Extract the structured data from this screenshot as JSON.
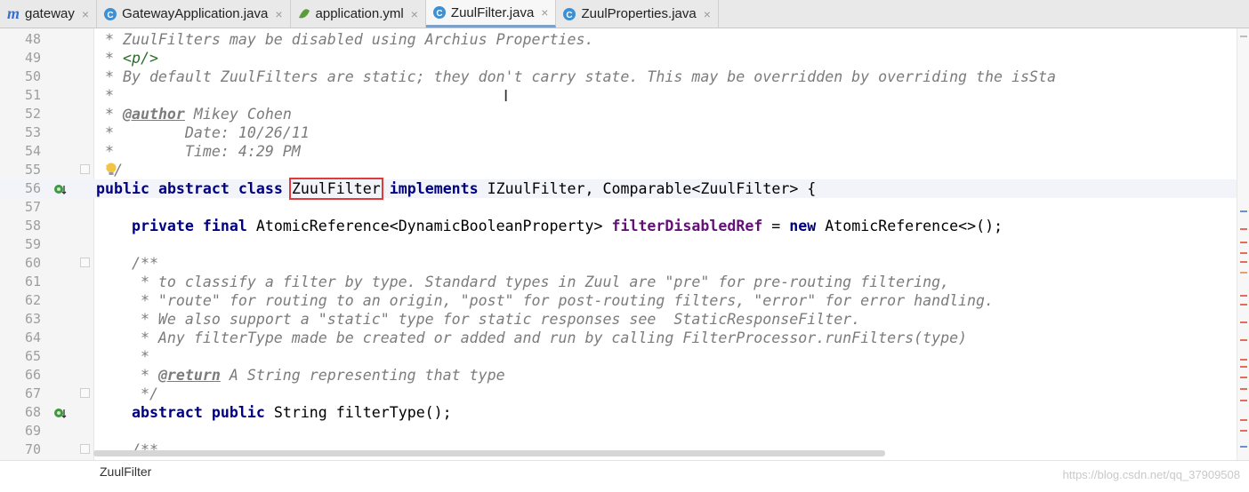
{
  "tabs": [
    {
      "label": "gateway",
      "icon": "maven-module-icon",
      "active": false
    },
    {
      "label": "GatewayApplication.java",
      "icon": "java-class-icon",
      "active": false
    },
    {
      "label": "application.yml",
      "icon": "yaml-file-icon",
      "active": false
    },
    {
      "label": "ZuulFilter.java",
      "icon": "java-class-icon",
      "active": true
    },
    {
      "label": "ZuulProperties.java",
      "icon": "java-class-icon",
      "active": false
    }
  ],
  "code": {
    "lines": [
      {
        "n": "48",
        "t": " * ZuulFilters may be disabled using Archius Properties."
      },
      {
        "n": "49",
        "t": " * <p/>"
      },
      {
        "n": "50",
        "t": " * By default ZuulFilters are static; they don't carry state. This may be overridden by overriding the isSta"
      },
      {
        "n": "51",
        "t": " *"
      },
      {
        "n": "52",
        "t": " * @author Mikey Cohen"
      },
      {
        "n": "53",
        "t": " *        Date: 10/26/11"
      },
      {
        "n": "54",
        "t": " *        Time: 4:29 PM"
      },
      {
        "n": "55",
        "t": " */"
      },
      {
        "n": "56",
        "t": "public abstract class ZuulFilter implements IZuulFilter, Comparable<ZuulFilter> {"
      },
      {
        "n": "57",
        "t": ""
      },
      {
        "n": "58",
        "t": "    private final AtomicReference<DynamicBooleanProperty> filterDisabledRef = new AtomicReference<>();"
      },
      {
        "n": "59",
        "t": ""
      },
      {
        "n": "60",
        "t": "    /**"
      },
      {
        "n": "61",
        "t": "     * to classify a filter by type. Standard types in Zuul are \"pre\" for pre-routing filtering,"
      },
      {
        "n": "62",
        "t": "     * \"route\" for routing to an origin, \"post\" for post-routing filters, \"error\" for error handling."
      },
      {
        "n": "63",
        "t": "     * We also support a \"static\" type for static responses see  StaticResponseFilter."
      },
      {
        "n": "64",
        "t": "     * Any filterType made be created or added and run by calling FilterProcessor.runFilters(type)"
      },
      {
        "n": "65",
        "t": "     *"
      },
      {
        "n": "66",
        "t": "     * @return A String representing that type"
      },
      {
        "n": "67",
        "t": "     */"
      },
      {
        "n": "68",
        "t": "    abstract public String filterType();"
      },
      {
        "n": "69",
        "t": ""
      },
      {
        "n": "70",
        "t": "    /**"
      }
    ]
  },
  "breadcrumb": "ZuulFilter",
  "watermark": "https://blog.csdn.net/qq_37909508",
  "colors": {
    "keyword": "#000080",
    "field": "#660e7a",
    "comment": "#7c7c7c",
    "highlight_box": "#e03a3a"
  }
}
